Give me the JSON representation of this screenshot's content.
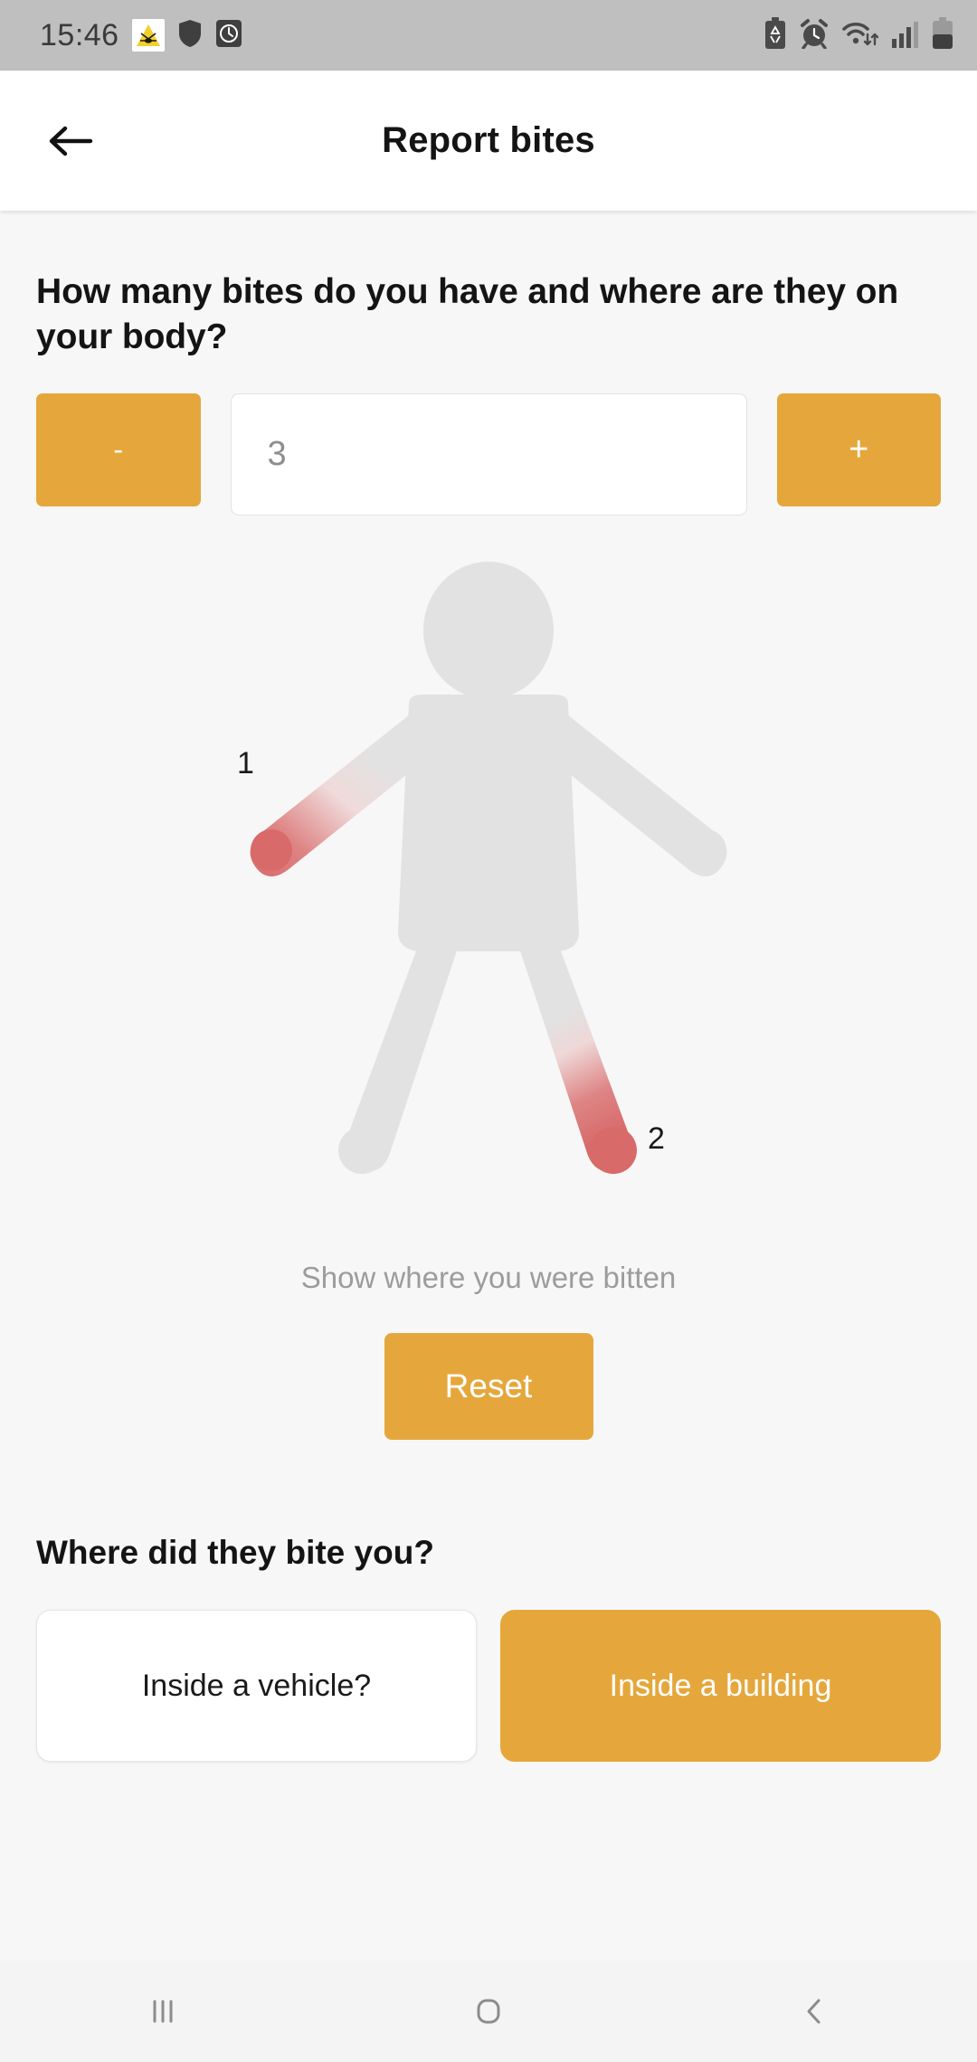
{
  "status_bar": {
    "time": "15:46",
    "left_icons": [
      "mosquito-warning-icon",
      "shield-icon",
      "clock-icon"
    ],
    "right_icons": [
      "battery-saver-icon",
      "alarm-icon",
      "wifi-icon",
      "signal-icon",
      "battery-icon"
    ],
    "background_color": "#BFBFBF"
  },
  "app_bar": {
    "back_icon": "back-arrow-icon",
    "title": "Report bites"
  },
  "bite_count_section": {
    "question": "How many bites do you have and where are they on your body?",
    "decrement_label": "-",
    "increment_label": "+",
    "count_value": "3"
  },
  "body_diagram": {
    "hint": "Show where you were bitten",
    "reset_label": "Reset",
    "markers": [
      {
        "label": "1",
        "location": "left-arm-forearm"
      },
      {
        "label": "2",
        "location": "right-leg-lower"
      }
    ],
    "body_color": "#E2E2E2",
    "bite_color": "#DC7070"
  },
  "location_section": {
    "question": "Where did they bite you?",
    "options": [
      {
        "label": "Inside a vehicle?",
        "selected": false
      },
      {
        "label": "Inside a building",
        "selected": true
      }
    ]
  },
  "nav_bar": {
    "recents_icon": "recents-icon",
    "home_icon": "home-icon",
    "back_icon": "nav-back-icon"
  },
  "theme": {
    "accent": "#E5A73C",
    "background": "#F7F7F7",
    "text": "#141414",
    "muted_text": "#9C9C9C"
  }
}
